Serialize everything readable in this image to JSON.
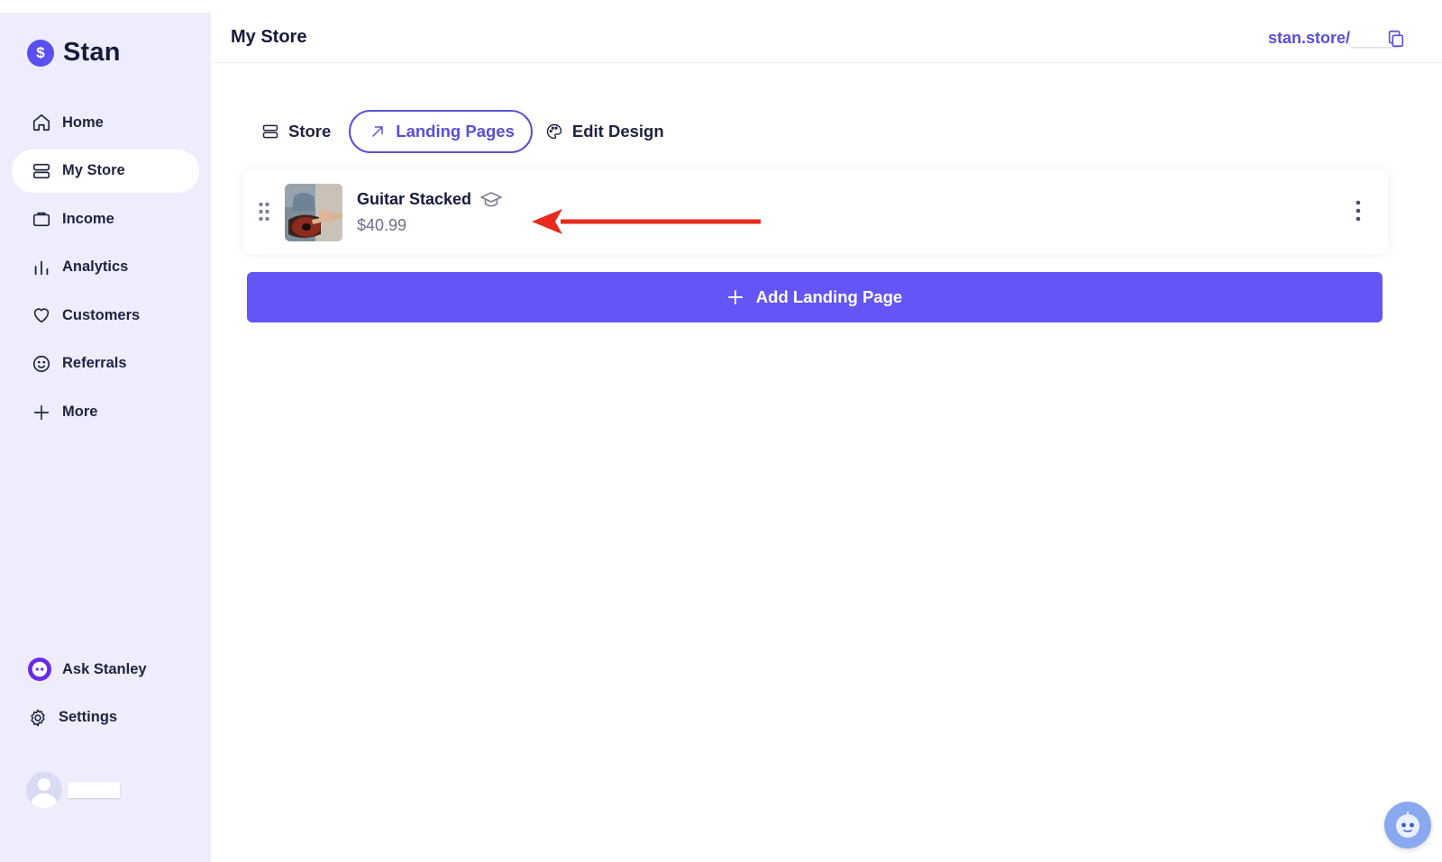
{
  "brand": {
    "name": "Stan",
    "logo_glyph": "$",
    "accent": "#5b4ff0"
  },
  "sidebar": {
    "items": [
      {
        "label": "Home",
        "icon": "home-icon"
      },
      {
        "label": "My Store",
        "icon": "store-icon",
        "active": true
      },
      {
        "label": "Income",
        "icon": "wallet-icon"
      },
      {
        "label": "Analytics",
        "icon": "bar-chart-icon"
      },
      {
        "label": "Customers",
        "icon": "heart-icon"
      },
      {
        "label": "Referrals",
        "icon": "smiley-icon"
      },
      {
        "label": "More",
        "icon": "plus-icon"
      }
    ],
    "bottom": [
      {
        "label": "Ask Stanley",
        "icon": "stanley-icon"
      },
      {
        "label": "Settings",
        "icon": "gear-icon"
      }
    ]
  },
  "header": {
    "title": "My Store",
    "store_link": "stan.store/"
  },
  "tabs": [
    {
      "label": "Store",
      "icon": "store-icon"
    },
    {
      "label": "Landing Pages",
      "icon": "arrow-up-right-icon",
      "active": true
    },
    {
      "label": "Edit Design",
      "icon": "palette-icon"
    }
  ],
  "products": [
    {
      "title": "Guitar Stacked",
      "price": "$40.99",
      "icon": "graduation-cap-icon"
    }
  ],
  "actions": {
    "add_label": "Add Landing Page"
  },
  "colors": {
    "sidebar_bg": "#eeedfd",
    "primary": "#6355f6",
    "link": "#5a4fd6",
    "annotation_arrow": "#e8291c"
  }
}
